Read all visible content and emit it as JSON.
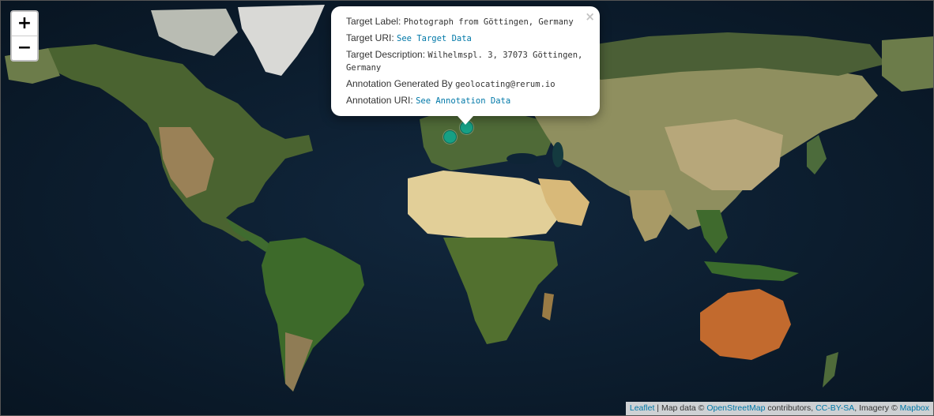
{
  "zoom": {
    "in_label": "+",
    "out_label": "−"
  },
  "popup": {
    "close": "×",
    "target_label_key": "Target Label:",
    "target_label_value": "Photograph from Göttingen, Germany",
    "target_uri_key": "Target URI:",
    "target_uri_link": "See Target Data",
    "target_desc_key": "Target Description:",
    "target_desc_value": "Wilhelmspl. 3, 37073 Göttingen, Germany",
    "generated_by_key": "Annotation Generated By",
    "generated_by_value": "geolocating@rerum.io",
    "annotation_uri_key": "Annotation URI:",
    "annotation_uri_link": "See Annotation Data"
  },
  "attribution": {
    "leaflet": "Leaflet",
    "sep": " | Map data © ",
    "osm": "OpenStreetMap",
    "contributors": " contributors, ",
    "license": "CC-BY-SA",
    "imagery": ", Imagery © ",
    "mapbox": "Mapbox"
  },
  "markers": [
    {
      "name": "Göttingen"
    },
    {
      "name": "second-marker"
    }
  ],
  "colors": {
    "ocean": "#0d2033",
    "marker": "#16a085",
    "link": "#0078a8"
  }
}
